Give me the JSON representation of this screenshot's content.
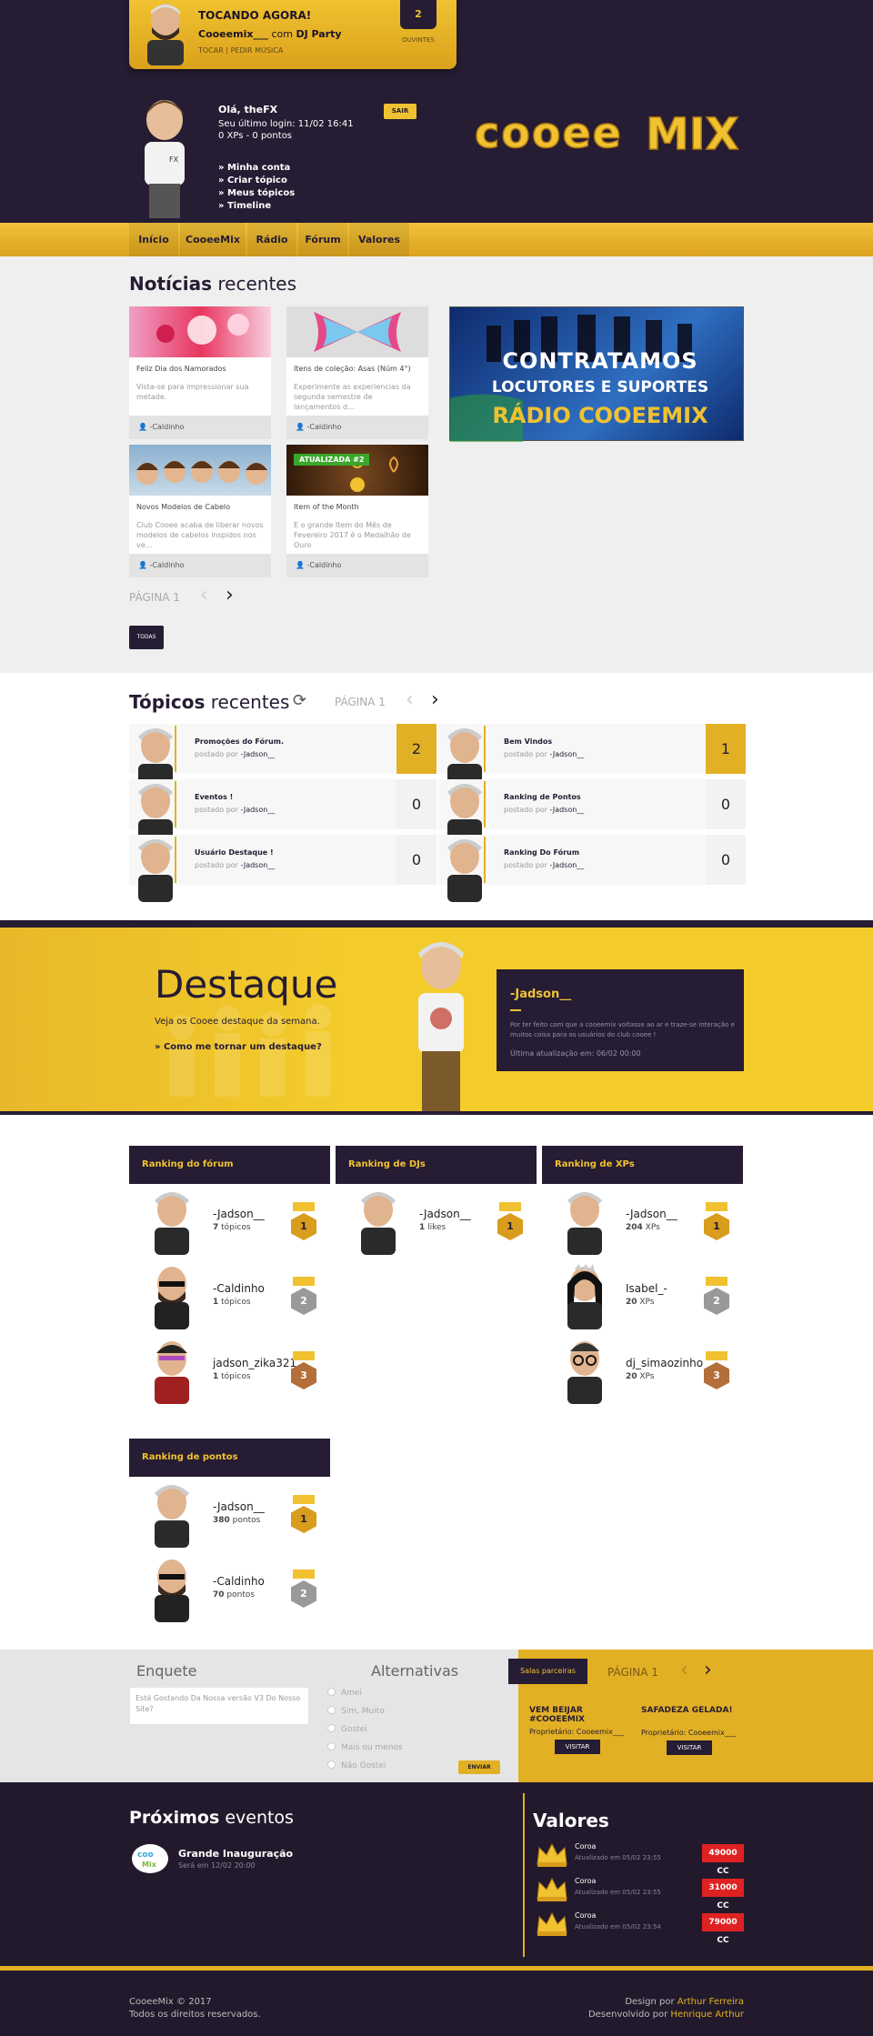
{
  "now_playing": {
    "title": "TOCANDO AGORA!",
    "dj_name": "Cooeemix___",
    "dj_with": "com",
    "dj_show": "DJ Party",
    "actions": "TOCAR | PEDIR MÚSICA",
    "listeners": "2",
    "listeners_label": "OUVINTES"
  },
  "user": {
    "greeting": "Olá, theFX",
    "last_login": "Seu último login: 11/02 16:41",
    "xp_line": "0 XPs - 0 pontos",
    "logout": "SAIR",
    "menu": [
      "» Minha conta",
      "» Criar tópico",
      "» Meus tópicos",
      "» Timeline"
    ]
  },
  "logo": {
    "text": "cooee MIX"
  },
  "nav": [
    "Início",
    "CooeeMix",
    "Rádio",
    "Fórum",
    "Valores"
  ],
  "news": {
    "title_bold": "Notícias",
    "title_rest": " recentes",
    "cards": [
      {
        "title": "Feliz Dia dos Namorados",
        "desc": "Vista-se para impressionar sua metade.",
        "author": "-Caldinho"
      },
      {
        "title": "Itens de coleção: Asas (Núm 4°)",
        "desc": "Experimente as experiencias da segunda semestre de lançamentos d...",
        "author": "-Caldinho"
      },
      {
        "title": "Novos Modelos de Cabelo",
        "desc": "Club Cooee acaba de liberar novos modelos de cabelos inspidos nos ve...",
        "author": "-Caldinho"
      },
      {
        "title": "Item of the Month",
        "desc": "E o grande Item do Mês de Fevereiro 2017 é o Medalhão de Ouro",
        "author": "-Caldinho",
        "badge": "ATUALIZADA #2"
      }
    ],
    "banner": {
      "line1": "CONTRATAMOS",
      "line2": "LOCUTORES E SUPORTES",
      "line3": "RÁDIO COOEEMIX"
    },
    "page": "PÁGINA 1",
    "all": "TODAS"
  },
  "topics": {
    "title_bold": "Tópicos",
    "title_rest": " recentes",
    "page": "PÁGINA 1",
    "posted_by": "postado por",
    "items": [
      {
        "title": "Promoções do Fórum.",
        "author": "-Jadson__",
        "count": "2",
        "hot": true
      },
      {
        "title": "Bem Vindos",
        "author": "-Jadson__",
        "count": "1",
        "hot": true
      },
      {
        "title": "Eventos !",
        "author": "-Jadson__",
        "count": "0",
        "hot": false
      },
      {
        "title": "Ranking de Pontos",
        "author": "-Jadson__",
        "count": "0",
        "hot": false
      },
      {
        "title": "Usuário Destaque !",
        "author": "-Jadson__",
        "count": "0",
        "hot": false
      },
      {
        "title": "Ranking Do Fórum",
        "author": "-Jadson__",
        "count": "0",
        "hot": false
      }
    ]
  },
  "featured": {
    "title": "Destaque",
    "subtitle": "Veja os Cooee destaque da semana.",
    "how": "» Como me tornar um destaque?",
    "name": "-Jadson__",
    "text": "Por ter feito com que a cooeemix voltasse ao ar e traze-se interação e muitos coisa para os usuários do club cooee !",
    "updated": "Última atualização em: 06/02 00:00"
  },
  "rankings": [
    {
      "title": "Ranking do fórum",
      "rows": [
        {
          "name": "-Jadson__",
          "count": "7",
          "unit": "tópicos",
          "pos": "1"
        },
        {
          "name": "-Caldinho",
          "count": "1",
          "unit": "tópicos",
          "pos": "2"
        },
        {
          "name": "jadson_zika321",
          "count": "1",
          "unit": "tópicos",
          "pos": "3"
        }
      ]
    },
    {
      "title": "Ranking de DJs",
      "rows": [
        {
          "name": "-Jadson__",
          "count": "1",
          "unit": "likes",
          "pos": "1"
        }
      ]
    },
    {
      "title": "Ranking de XPs",
      "rows": [
        {
          "name": "-Jadson__",
          "count": "204",
          "unit": "XPs",
          "pos": "1"
        },
        {
          "name": "Isabel_-",
          "count": "20",
          "unit": "XPs",
          "pos": "2"
        },
        {
          "name": "dj_simaozinho",
          "count": "20",
          "unit": "XPs",
          "pos": "3"
        }
      ]
    },
    {
      "title": "Ranking de pontos",
      "rows": [
        {
          "name": "-Jadson__",
          "count": "380",
          "unit": "pontos",
          "pos": "1"
        },
        {
          "name": "-Caldinho",
          "count": "70",
          "unit": "pontos",
          "pos": "2"
        }
      ]
    }
  ],
  "poll": {
    "title": "Enquete",
    "alt_title": "Alternativas",
    "question": "Está Gostando Da Nossa versão V3 Do Nosso Site?",
    "options": [
      "Amei",
      "Sim, Muito",
      "Gostei",
      "Mais ou menos",
      "Não Gostei"
    ],
    "send": "ENVIAR"
  },
  "rooms": {
    "tab": "Salas parceiras",
    "page": "PÁGINA 1",
    "items": [
      {
        "title": "VEM BEIJAR #COOEEMIX",
        "owner": "Proprietário: Cooeemix___",
        "visit": "VISITAR"
      },
      {
        "title": "SAFADEZA GELADA!",
        "owner": "Proprietário: Cooeemix___",
        "visit": "VISITAR"
      }
    ]
  },
  "events": {
    "title_bold": "Próximos",
    "title_rest": " eventos",
    "items": [
      {
        "name": "Grande Inauguração",
        "date": "Será em 12/02 20:00"
      }
    ]
  },
  "values": {
    "title": "Valores",
    "items": [
      {
        "name": "Coroa",
        "updated": "Atualizado em 05/02 23:55",
        "price": "49000 CC"
      },
      {
        "name": "Coroa",
        "updated": "Atualizado em 05/02 23:55",
        "price": "31000 CC"
      },
      {
        "name": "Coroa",
        "updated": "Atualizado em 05/02 23:54",
        "price": "79000 CC"
      }
    ]
  },
  "footer": {
    "copy": "CooeeMix © 2017",
    "rights": "Todos os direitos reservados.",
    "design_by": "Design por",
    "designer": "Arthur Ferreira",
    "dev_by": "Desenvolvido por",
    "developer": "Henrique Arthur"
  },
  "colors": {
    "dark": "#261c33",
    "gold": "#f0c231",
    "red": "#e02121"
  }
}
